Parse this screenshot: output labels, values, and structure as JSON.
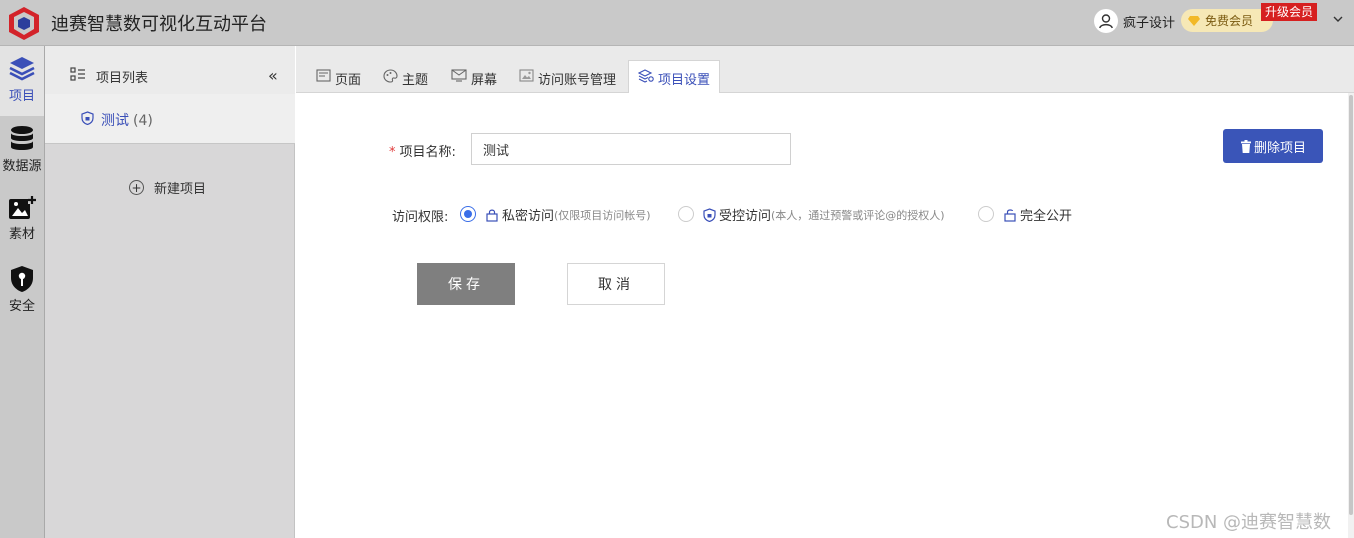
{
  "header": {
    "app_title": "迪赛智慧数可视化互动平台",
    "user_name": "疯子设计",
    "vip_label": "免费会员",
    "upgrade_label": "升级会员"
  },
  "rail": {
    "items": [
      {
        "label": "项目",
        "icon": "layers-icon",
        "active": true
      },
      {
        "label": "数据源",
        "icon": "database-icon"
      },
      {
        "label": "素材",
        "icon": "image-add-icon"
      },
      {
        "label": "安全",
        "icon": "shield-key-icon"
      }
    ]
  },
  "project_list": {
    "title": "项目列表",
    "items": [
      {
        "name": "测试",
        "count": "(4)"
      }
    ],
    "new_project_label": "新建项目"
  },
  "tabs": [
    {
      "label": "页面",
      "icon": "page-icon"
    },
    {
      "label": "主题",
      "icon": "palette-icon"
    },
    {
      "label": "屏幕",
      "icon": "screen-icon"
    },
    {
      "label": "访问账号管理",
      "icon": "image-icon"
    },
    {
      "label": "项目设置",
      "icon": "settings-layers-icon",
      "active": true
    }
  ],
  "form": {
    "required_mark": "*",
    "name_label": "项目名称:",
    "name_value": "测试",
    "delete_label": "删除项目",
    "permission_label": "访问权限:",
    "options": [
      {
        "label": "私密访问",
        "hint": "(仅限项目访问帐号)",
        "checked": true
      },
      {
        "label": "受控访问",
        "hint": "(本人，通过预警或评论@的授权人)",
        "checked": false
      },
      {
        "label": "完全公开",
        "hint": "",
        "checked": false
      }
    ],
    "save_label": "保存",
    "cancel_label": "取消"
  },
  "watermark": "CSDN @迪赛智慧数",
  "colors": {
    "accent": "#3a4fb8",
    "delete_button": "#3a55b8",
    "save_button": "#7f7f7f",
    "upgrade_badge": "#d62020",
    "header_bg": "#c9c9c9"
  }
}
